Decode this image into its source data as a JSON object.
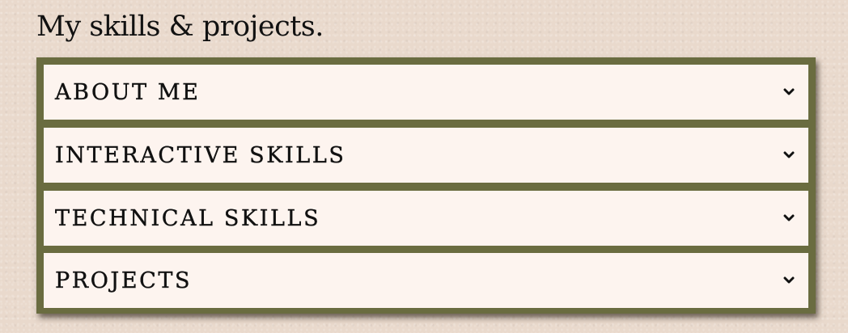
{
  "page": {
    "title": "My skills & projects."
  },
  "accordion": {
    "items": [
      {
        "label": "ABOUT ME",
        "icon": "chevron-down-icon"
      },
      {
        "label": "INTERACTIVE SKILLS",
        "icon": "chevron-down-icon"
      },
      {
        "label": "TECHNICAL SKILLS",
        "icon": "chevron-down-icon"
      },
      {
        "label": "PROJECTS",
        "icon": "chevron-down-icon"
      }
    ]
  },
  "colors": {
    "background": "#e9d9cc",
    "frame": "#6a6c40",
    "item_background": "#fdf4ef",
    "text": "#111111"
  }
}
